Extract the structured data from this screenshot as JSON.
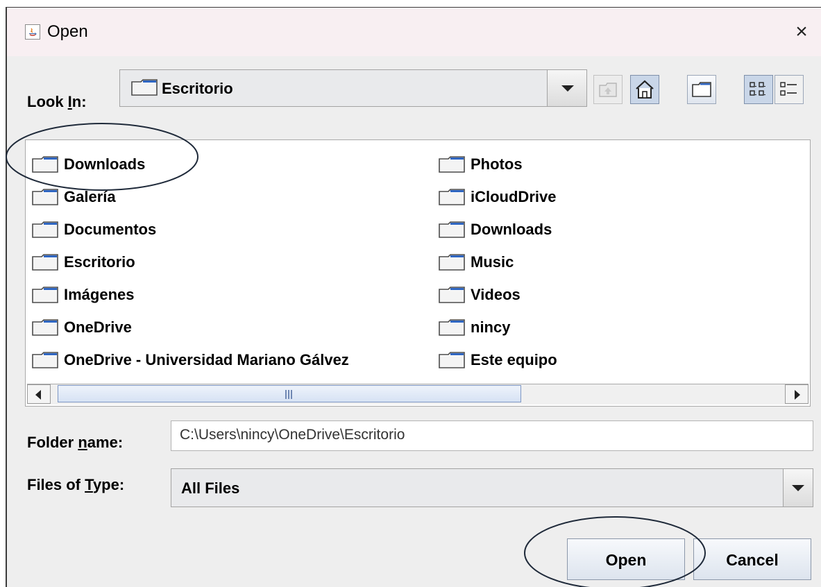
{
  "window": {
    "title": "Open",
    "close_glyph": "×"
  },
  "look_in": {
    "label_prefix": "Look ",
    "mnemonic": "I",
    "label_suffix": "n:",
    "value": "Escritorio"
  },
  "toolbar": {
    "icons": [
      "up-one-level-icon",
      "home-icon",
      "new-folder-icon",
      "list-view-icon",
      "details-view-icon"
    ]
  },
  "files": {
    "column1": [
      "Downloads",
      "Galería",
      "Documentos",
      "Escritorio",
      "Imágenes",
      "OneDrive",
      "OneDrive - Universidad Mariano Gálvez"
    ],
    "column2": [
      "Photos",
      "iCloudDrive",
      "Downloads",
      "Music",
      "Videos",
      "nincy",
      "Este equipo"
    ]
  },
  "folder_name": {
    "label_prefix": "Folder ",
    "mnemonic": "n",
    "label_suffix": "ame:",
    "value": "C:\\Users\\nincy\\OneDrive\\Escritorio"
  },
  "files_of_type": {
    "label_prefix": "Files of ",
    "mnemonic": "T",
    "label_suffix": "ype:",
    "value": "All Files"
  },
  "buttons": {
    "open": "Open",
    "cancel": "Cancel"
  },
  "annotations": {
    "circled": [
      "Downloads",
      "Open"
    ],
    "color": "#1f2a3a"
  }
}
